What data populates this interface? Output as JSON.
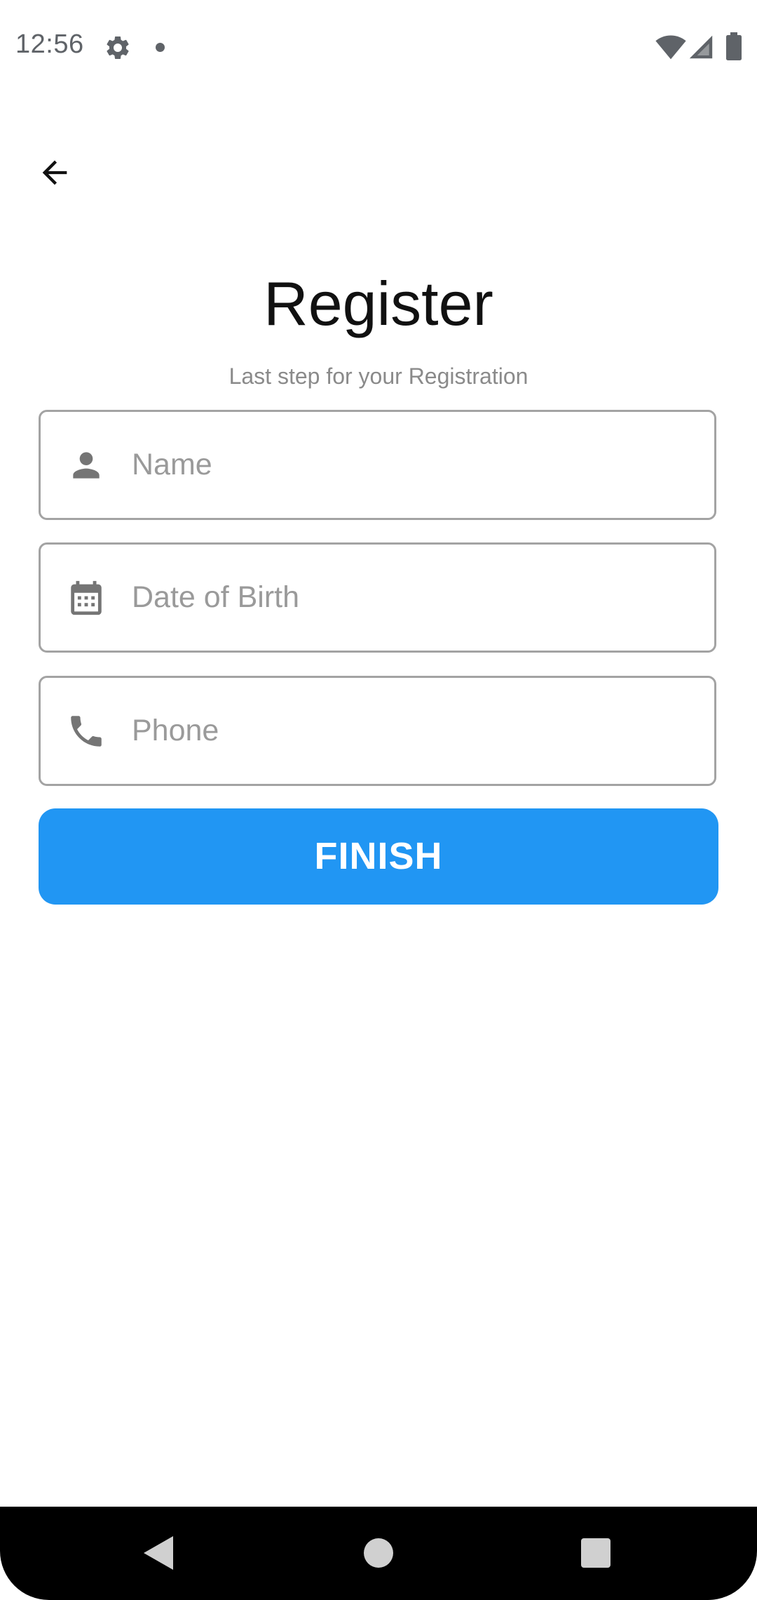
{
  "status_bar": {
    "time": "12:56",
    "icons": [
      "gear-icon",
      "notification-dot",
      "wifi-icon",
      "signal-icon",
      "battery-icon"
    ]
  },
  "header": {
    "back_icon": "arrow-left-icon"
  },
  "page": {
    "title": "Register",
    "subtitle": "Last step for your Registration"
  },
  "form": {
    "fields": [
      {
        "icon": "person-icon",
        "placeholder": "Name",
        "value": ""
      },
      {
        "icon": "calendar-icon",
        "placeholder": "Date of Birth",
        "value": ""
      },
      {
        "icon": "phone-icon",
        "placeholder": "Phone",
        "value": ""
      }
    ],
    "submit_label": "FINISH"
  },
  "colors": {
    "accent": "#2196f3",
    "icon_gray": "#757575",
    "border": "#a3a3a3",
    "placeholder": "#9a9a9a"
  },
  "nav_bar": {
    "icons": [
      "nav-back-icon",
      "nav-home-icon",
      "nav-recents-icon"
    ]
  }
}
